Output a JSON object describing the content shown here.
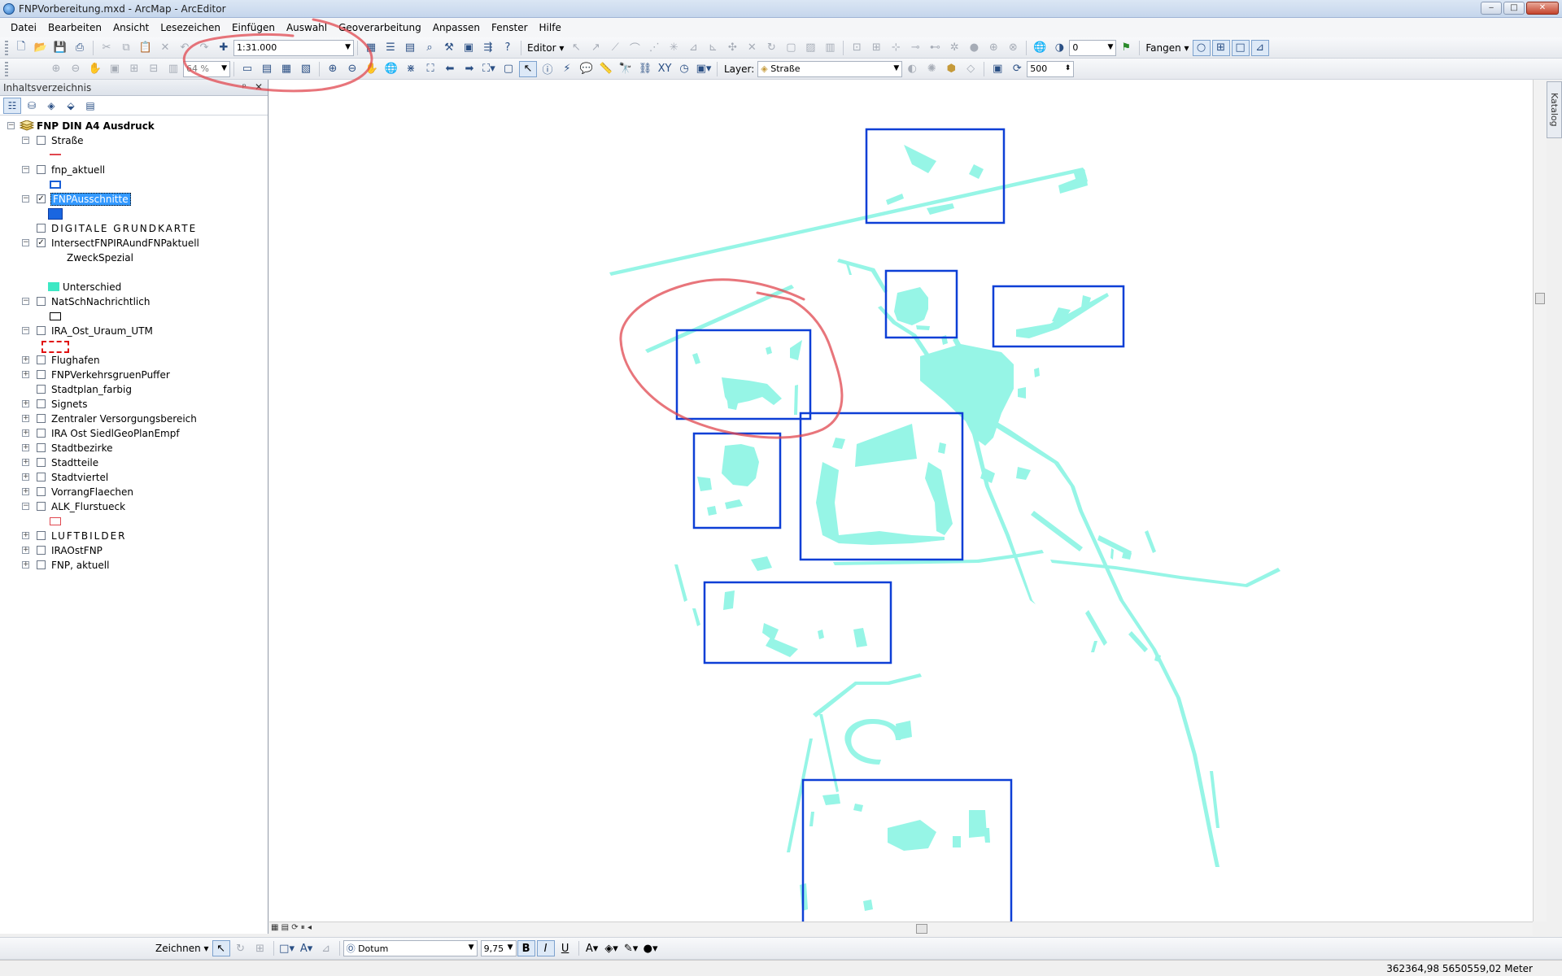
{
  "window": {
    "title": "FNPVorbereitung.mxd - ArcMap - ArcEditor",
    "buttons": {
      "minimize": "‒",
      "maximize": "□",
      "close": "✕"
    }
  },
  "menu": [
    "Datei",
    "Bearbeiten",
    "Ansicht",
    "Lesezeichen",
    "Einfügen",
    "Auswahl",
    "Geoverarbeitung",
    "Anpassen",
    "Fenster",
    "Hilfe"
  ],
  "toolbar1": {
    "scale": "1:31.000",
    "editor_label": "Editor",
    "snap_value": "0",
    "fangen_label": "Fangen"
  },
  "toolbar2": {
    "zoom_percent": "64 %",
    "layer_label": "Layer:",
    "layer_value": "Straße",
    "tolerance_value": "500"
  },
  "toc": {
    "header": "Inhaltsverzeichnis",
    "pin": "ᵖ",
    "close": "✕",
    "root": "FNP DIN A4 Ausdruck",
    "layers": [
      {
        "name": "Straße",
        "checked": false,
        "expander": "minus"
      },
      {
        "name": "fnp_aktuell",
        "checked": false,
        "expander": "minus"
      },
      {
        "name": "FNPAusschnitte",
        "checked": true,
        "expander": "minus",
        "selected": true
      },
      {
        "name": "DIGITALE GRUNDKARTE",
        "checked": false,
        "expander": "none"
      },
      {
        "name": "IntersectFNPIRAundFNPaktuell",
        "checked": true,
        "expander": "minus"
      },
      {
        "name": "NatSchNachrichtlich",
        "checked": false,
        "expander": "minus"
      },
      {
        "name": "IRA_Ost_Uraum_UTM",
        "checked": false,
        "expander": "minus"
      },
      {
        "name": "Flughafen",
        "checked": false,
        "expander": "plus"
      },
      {
        "name": "FNPVerkehrsgruenPuffer",
        "checked": false,
        "expander": "plus"
      },
      {
        "name": "Stadtplan_farbig",
        "checked": false,
        "expander": "none"
      },
      {
        "name": "Signets",
        "checked": false,
        "expander": "plus"
      },
      {
        "name": "Zentraler Versorgungsbereich",
        "checked": false,
        "expander": "plus"
      },
      {
        "name": "IRA Ost SiedlGeoPlanEmpf",
        "checked": false,
        "expander": "plus"
      },
      {
        "name": "Stadtbezirke",
        "checked": false,
        "expander": "plus"
      },
      {
        "name": "Stadtteile",
        "checked": false,
        "expander": "plus"
      },
      {
        "name": "Stadtviertel",
        "checked": false,
        "expander": "plus"
      },
      {
        "name": "VorrangFlaechen",
        "checked": false,
        "expander": "plus"
      },
      {
        "name": "ALK_Flurstueck",
        "checked": false,
        "expander": "minus"
      },
      {
        "name": "LUFTBILDER",
        "checked": false,
        "expander": "plus"
      },
      {
        "name": "IRAOstFNP",
        "checked": false,
        "expander": "plus"
      },
      {
        "name": "FNP, aktuell",
        "checked": false,
        "expander": "plus"
      }
    ],
    "field_label": "ZweckSpezial",
    "class_label": "Unterschied"
  },
  "catalog_tab": "Katalog",
  "drawbar": {
    "zeichnen_label": "Zeichnen",
    "font_name": "Dotum",
    "font_size": "9,75",
    "bold": "B",
    "italic": "I",
    "underline": "U"
  },
  "status": {
    "coordinates": "362364,98  5650559,02 Meter"
  },
  "colors": {
    "polygon_fill": "#96f5e6",
    "frame_stroke": "#0d3fd6",
    "annotation_red": "#e0474f",
    "selection": "#3399ff",
    "class_swatch": "#3de8c4"
  }
}
